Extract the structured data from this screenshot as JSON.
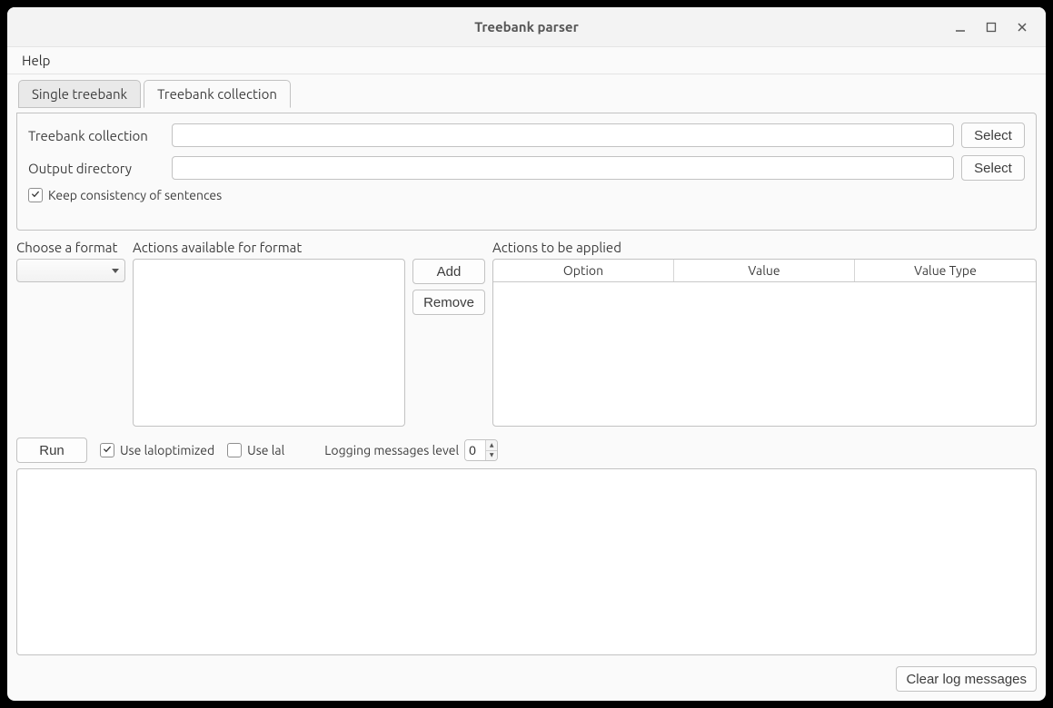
{
  "window": {
    "title": "Treebank parser"
  },
  "menu": {
    "help": "Help"
  },
  "tabs": {
    "single": "Single treebank",
    "collection": "Treebank collection"
  },
  "form": {
    "collection_label": "Treebank collection",
    "collection_value": "",
    "output_label": "Output directory",
    "output_value": "",
    "select_btn": "Select",
    "keep_consistency": "Keep consistency of sentences",
    "keep_consistency_checked": true
  },
  "mid": {
    "choose_format": "Choose a format",
    "actions_available": "Actions available for format",
    "actions_applied": "Actions to be applied",
    "add_btn": "Add",
    "remove_btn": "Remove",
    "format_value": "",
    "columns": {
      "option": "Option",
      "value": "Value",
      "value_type": "Value Type"
    }
  },
  "run": {
    "run_btn": "Run",
    "use_laloptimized": "Use laloptimized",
    "use_laloptimized_checked": true,
    "use_lal": "Use lal",
    "use_lal_checked": false,
    "logging_label": "Logging messages level",
    "logging_value": "0"
  },
  "bottom": {
    "clear_btn": "Clear log messages"
  }
}
